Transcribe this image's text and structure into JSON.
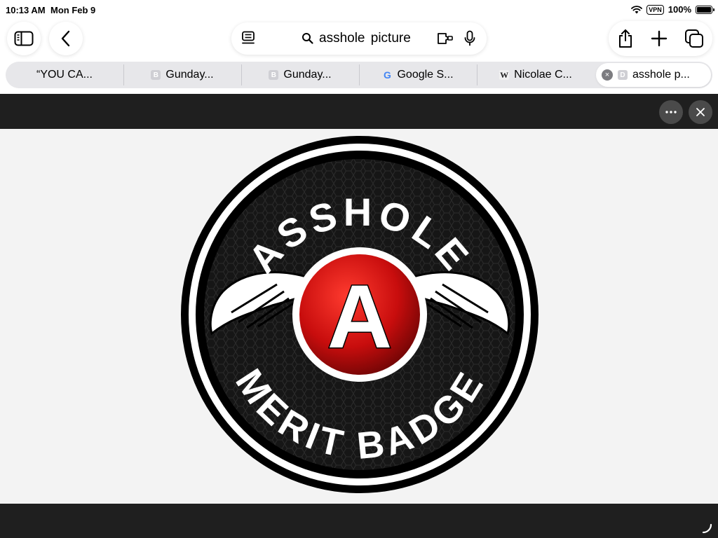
{
  "status_bar": {
    "time": "10:13 AM",
    "date": "Mon Feb 9",
    "vpn": "VPN",
    "battery": "100%"
  },
  "toolbar": {
    "sidebar_icon": "sidebar-icon",
    "back_icon": "chevron-left-icon",
    "share_icon": "share-icon",
    "new_tab_icon": "plus-icon",
    "tabs_overview_icon": "tabs-overview-icon"
  },
  "address_bar": {
    "query": "asshole  picture",
    "reader_icon": "page-menu-icon",
    "search_icon": "search-icon",
    "extension_icon": "extension-icon",
    "mic_icon": "microphone-icon"
  },
  "tabs": [
    {
      "label": "“YOU CA...",
      "favicon": ""
    },
    {
      "label": "Gunday...",
      "favicon": "B"
    },
    {
      "label": "Gunday...",
      "favicon": "B"
    },
    {
      "label": "Google S...",
      "favicon": "G"
    },
    {
      "label": "Nicolae C...",
      "favicon": "W"
    },
    {
      "label": "asshole p...",
      "favicon": "D",
      "active": true
    }
  ],
  "viewer": {
    "more_icon": "ellipsis-icon",
    "close_icon": "close-icon",
    "badge": {
      "top_text": "ASSHOLE",
      "bottom_text": "MERIT BADGE",
      "center_letter": "A",
      "colors": {
        "ring": "#000000",
        "inner_ring": "#ffffff",
        "field": "#1a1a1a",
        "emblem": "#d0100f"
      }
    }
  }
}
